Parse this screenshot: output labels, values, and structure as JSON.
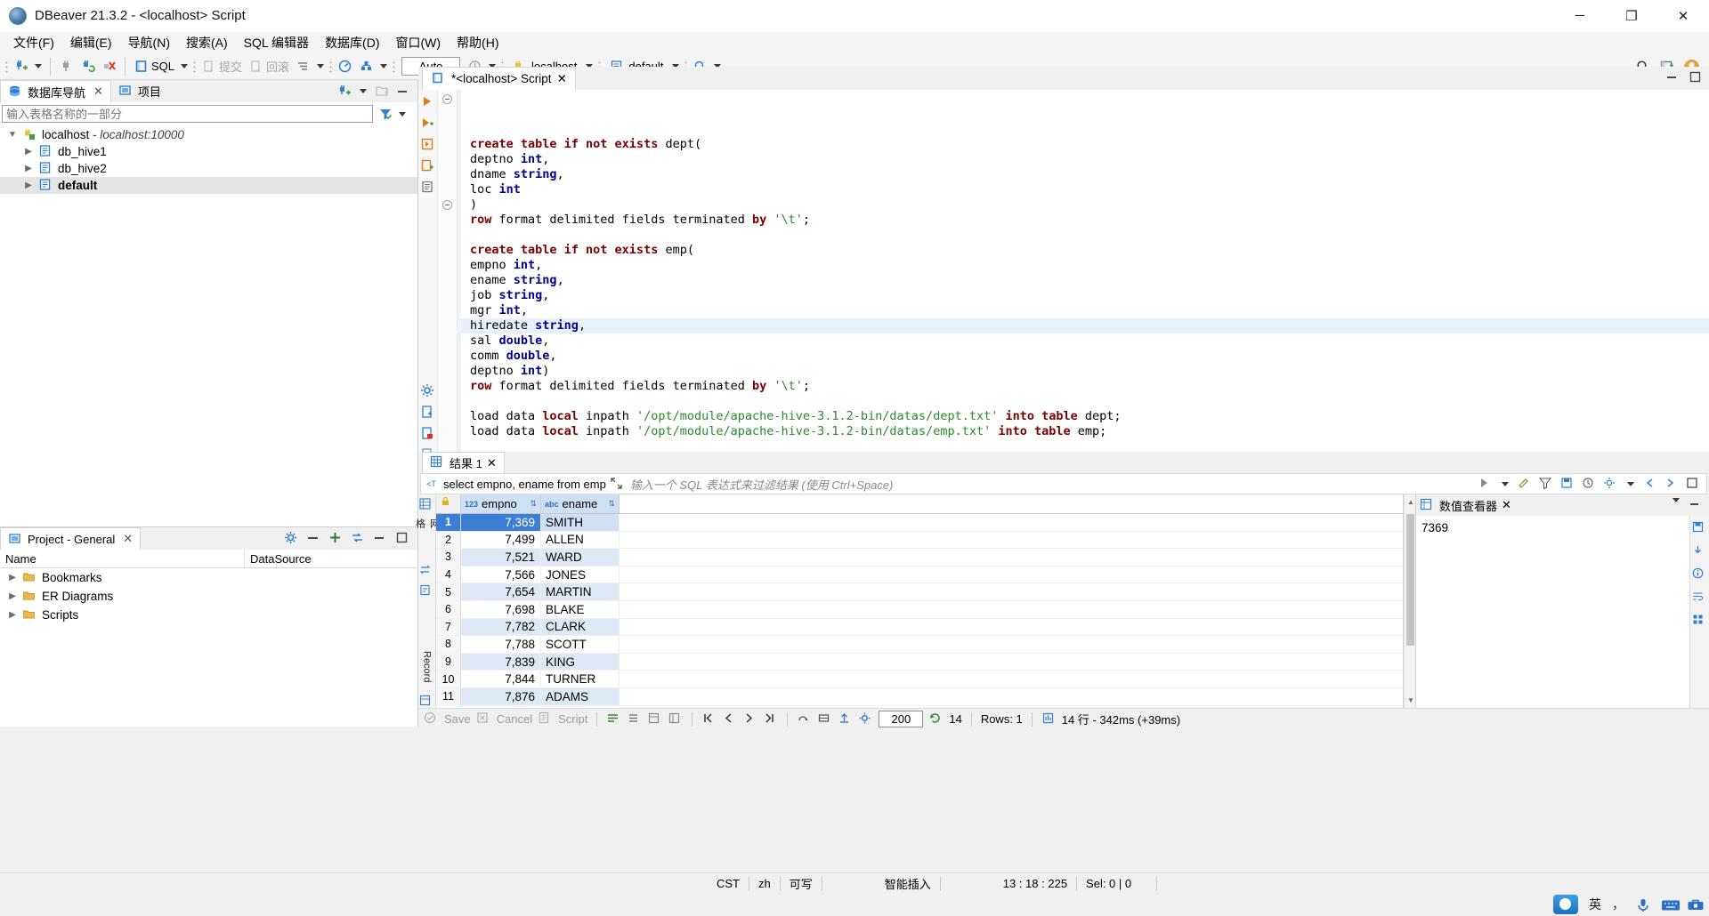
{
  "window": {
    "title": "DBeaver 21.3.2 - <localhost> Script",
    "minimize": "─",
    "maximize": "❐",
    "close": "✕"
  },
  "menubar": {
    "items": [
      {
        "label": "文件(F)"
      },
      {
        "label": "编辑(E)"
      },
      {
        "label": "导航(N)"
      },
      {
        "label": "搜索(A)"
      },
      {
        "label": "SQL 编辑器"
      },
      {
        "label": "数据库(D)"
      },
      {
        "label": "窗口(W)"
      },
      {
        "label": "帮助(H)"
      }
    ]
  },
  "toolbar": {
    "sql_label": "SQL",
    "commit_label": "提交",
    "rollback_label": "回滚",
    "auto_label": "Auto",
    "connection": "localhost",
    "schema": "default",
    "icons": {
      "new_connection": "new-connection-icon",
      "disconnect": "disconnect-icon",
      "refresh": "refresh-connection-icon",
      "invalidate": "invalidate-icon",
      "sql_editor": "sql-editor-icon",
      "commit": "commit-icon",
      "rollback": "rollback-icon",
      "transaction_mode": "transaction-mode-icon",
      "dashboard": "dashboard-icon",
      "database_manage": "database-manage-icon",
      "history": "history-icon",
      "search": "search-icon",
      "perspective": "perspective-icon",
      "user": "user-icon"
    }
  },
  "navigator": {
    "tabs": [
      {
        "label": "数据库导航",
        "icon": "database-navigator-icon",
        "active": true,
        "closable": true
      },
      {
        "label": "项目",
        "icon": "project-icon",
        "active": false,
        "closable": false
      }
    ],
    "filter_placeholder": "输入表格名称的一部分",
    "filter_value": "",
    "tree": [
      {
        "label": "localhost",
        "sub": " - localhost:10000",
        "depth": 0,
        "expanded": true,
        "icon": "connection-icon",
        "bold": false,
        "selected": false
      },
      {
        "label": "db_hive1",
        "sub": "",
        "depth": 1,
        "expanded": false,
        "icon": "database-icon",
        "bold": false,
        "selected": false
      },
      {
        "label": "db_hive2",
        "sub": "",
        "depth": 1,
        "expanded": false,
        "icon": "database-icon",
        "bold": false,
        "selected": false
      },
      {
        "label": "default",
        "sub": "",
        "depth": 1,
        "expanded": false,
        "icon": "database-icon",
        "bold": true,
        "selected": true
      }
    ]
  },
  "project": {
    "tab_label": "Project - General",
    "columns": [
      "Name",
      "DataSource"
    ],
    "rows": [
      {
        "label": "Bookmarks",
        "icon": "bookmarks-folder-icon"
      },
      {
        "label": "ER Diagrams",
        "icon": "er-diagrams-folder-icon"
      },
      {
        "label": "Scripts",
        "icon": "scripts-folder-icon"
      }
    ]
  },
  "editor": {
    "tab_label": "*<localhost> Script",
    "tab_icon": "sql-script-icon",
    "lines": [
      {
        "text": "create table if not exists dept(",
        "fold": true,
        "hl": false,
        "tokens": [
          {
            "t": "create table if not exists ",
            "c": "kw"
          },
          {
            "t": "dept(",
            "c": "pl"
          }
        ]
      },
      {
        "text": "deptno int,",
        "fold": false,
        "hl": false,
        "tokens": [
          {
            "t": "deptno ",
            "c": "pl"
          },
          {
            "t": "int",
            "c": "typ"
          },
          {
            "t": ",",
            "c": "pl"
          }
        ]
      },
      {
        "text": "dname string,",
        "fold": false,
        "hl": false,
        "tokens": [
          {
            "t": "dname ",
            "c": "pl"
          },
          {
            "t": "string",
            "c": "typ"
          },
          {
            "t": ",",
            "c": "pl"
          }
        ]
      },
      {
        "text": "loc int",
        "fold": false,
        "hl": false,
        "tokens": [
          {
            "t": "loc ",
            "c": "pl"
          },
          {
            "t": "int",
            "c": "typ"
          }
        ]
      },
      {
        "text": ")",
        "fold": false,
        "hl": false,
        "tokens": [
          {
            "t": ")",
            "c": "pl"
          }
        ]
      },
      {
        "text": "row format delimited fields terminated by '\\t';",
        "fold": false,
        "hl": false,
        "tokens": [
          {
            "t": "row",
            "c": "kw"
          },
          {
            "t": " format delimited fields terminated ",
            "c": "pl"
          },
          {
            "t": "by",
            "c": "kw"
          },
          {
            "t": " ",
            "c": "pl"
          },
          {
            "t": "'\\t'",
            "c": "str"
          },
          {
            "t": ";",
            "c": "pl"
          }
        ]
      },
      {
        "text": "",
        "fold": false,
        "hl": false,
        "tokens": []
      },
      {
        "text": "create table if not exists emp(",
        "fold": true,
        "hl": false,
        "tokens": [
          {
            "t": "create table if not exists ",
            "c": "kw"
          },
          {
            "t": "emp(",
            "c": "pl"
          }
        ]
      },
      {
        "text": "empno int,",
        "fold": false,
        "hl": false,
        "tokens": [
          {
            "t": "empno ",
            "c": "pl"
          },
          {
            "t": "int",
            "c": "typ"
          },
          {
            "t": ",",
            "c": "pl"
          }
        ]
      },
      {
        "text": "ename string,",
        "fold": false,
        "hl": false,
        "tokens": [
          {
            "t": "ename ",
            "c": "pl"
          },
          {
            "t": "string",
            "c": "typ"
          },
          {
            "t": ",",
            "c": "pl"
          }
        ]
      },
      {
        "text": "job string,",
        "fold": false,
        "hl": false,
        "tokens": [
          {
            "t": "job ",
            "c": "pl"
          },
          {
            "t": "string",
            "c": "typ"
          },
          {
            "t": ",",
            "c": "pl"
          }
        ]
      },
      {
        "text": "mgr int,",
        "fold": false,
        "hl": false,
        "tokens": [
          {
            "t": "mgr ",
            "c": "pl"
          },
          {
            "t": "int",
            "c": "typ"
          },
          {
            "t": ",",
            "c": "pl"
          }
        ]
      },
      {
        "text": "hiredate string,",
        "fold": false,
        "hl": true,
        "tokens": [
          {
            "t": "hiredate ",
            "c": "pl"
          },
          {
            "t": "string",
            "c": "typ"
          },
          {
            "t": ",",
            "c": "pl"
          }
        ]
      },
      {
        "text": "sal double,",
        "fold": false,
        "hl": false,
        "tokens": [
          {
            "t": "sal ",
            "c": "pl"
          },
          {
            "t": "double",
            "c": "typ"
          },
          {
            "t": ",",
            "c": "pl"
          }
        ]
      },
      {
        "text": "comm double,",
        "fold": false,
        "hl": false,
        "tokens": [
          {
            "t": "comm ",
            "c": "pl"
          },
          {
            "t": "double",
            "c": "typ"
          },
          {
            "t": ",",
            "c": "pl"
          }
        ]
      },
      {
        "text": "deptno int)",
        "fold": false,
        "hl": false,
        "tokens": [
          {
            "t": "deptno ",
            "c": "pl"
          },
          {
            "t": "int",
            "c": "typ"
          },
          {
            "t": ")",
            "c": "pl"
          }
        ]
      },
      {
        "text": "row format delimited fields terminated by '\\t';",
        "fold": false,
        "hl": false,
        "tokens": [
          {
            "t": "row",
            "c": "kw"
          },
          {
            "t": " format delimited fields terminated ",
            "c": "pl"
          },
          {
            "t": "by",
            "c": "kw"
          },
          {
            "t": " ",
            "c": "pl"
          },
          {
            "t": "'\\t'",
            "c": "str"
          },
          {
            "t": ";",
            "c": "pl"
          }
        ]
      },
      {
        "text": "",
        "fold": false,
        "hl": false,
        "tokens": []
      },
      {
        "text": "load data local inpath '/opt/module/apache-hive-3.1.2-bin/datas/dept.txt' into table dept;",
        "fold": false,
        "hl": false,
        "tokens": [
          {
            "t": "load data ",
            "c": "pl"
          },
          {
            "t": "local",
            "c": "kw"
          },
          {
            "t": " inpath ",
            "c": "pl"
          },
          {
            "t": "'/opt/module/apache-hive-3.1.2-bin/datas/dept.txt'",
            "c": "str"
          },
          {
            "t": " ",
            "c": "pl"
          },
          {
            "t": "into table",
            "c": "kw"
          },
          {
            "t": " dept;",
            "c": "pl"
          }
        ]
      },
      {
        "text": "load data local inpath '/opt/module/apache-hive-3.1.2-bin/datas/emp.txt' into table emp;",
        "fold": false,
        "hl": false,
        "tokens": [
          {
            "t": "load data ",
            "c": "pl"
          },
          {
            "t": "local",
            "c": "kw"
          },
          {
            "t": " inpath ",
            "c": "pl"
          },
          {
            "t": "'/opt/module/apache-hive-3.1.2-bin/datas/emp.txt'",
            "c": "str"
          },
          {
            "t": " ",
            "c": "pl"
          },
          {
            "t": "into table",
            "c": "kw"
          },
          {
            "t": " emp;",
            "c": "pl"
          }
        ]
      },
      {
        "text": "",
        "fold": false,
        "hl": false,
        "tokens": []
      },
      {
        "text": "select empno, ename from emp;",
        "fold": false,
        "hl": false,
        "tokens": [
          {
            "t": "select",
            "c": "kw"
          },
          {
            "t": " empno, ename ",
            "c": "pl"
          },
          {
            "t": "from",
            "c": "kw"
          },
          {
            "t": " emp",
            "c": "pl"
          },
          {
            "t": ";",
            "c": "pl"
          }
        ]
      }
    ]
  },
  "results": {
    "tab_label": "结果 1",
    "tab_icon": "grid-icon",
    "filter_query": "select empno, ename from emp",
    "filter_placeholder": "输入一个 SQL 表达式来过滤结果 (使用 Ctrl+Space)",
    "columns": [
      {
        "name": "empno",
        "type_badge": "123"
      },
      {
        "name": "ename",
        "type_badge": "abc"
      }
    ],
    "rows": [
      {
        "n": "1",
        "empno": "7,369",
        "ename": "SMITH"
      },
      {
        "n": "2",
        "empno": "7,499",
        "ename": "ALLEN"
      },
      {
        "n": "3",
        "empno": "7,521",
        "ename": "WARD"
      },
      {
        "n": "4",
        "empno": "7,566",
        "ename": "JONES"
      },
      {
        "n": "5",
        "empno": "7,654",
        "ename": "MARTIN"
      },
      {
        "n": "6",
        "empno": "7,698",
        "ename": "BLAKE"
      },
      {
        "n": "7",
        "empno": "7,782",
        "ename": "CLARK"
      },
      {
        "n": "8",
        "empno": "7,788",
        "ename": "SCOTT"
      },
      {
        "n": "9",
        "empno": "7,839",
        "ename": "KING"
      },
      {
        "n": "10",
        "empno": "7,844",
        "ename": "TURNER"
      },
      {
        "n": "11",
        "empno": "7,876",
        "ename": "ADAMS"
      }
    ],
    "side_labels": {
      "grid": "网格",
      "record": "Record"
    },
    "footer": {
      "save": "Save",
      "cancel": "Cancel",
      "script": "Script",
      "row_limit": "200",
      "fetch_count": "14",
      "rows_label": "Rows: 1",
      "status": "14 行 - 342ms (+39ms)"
    }
  },
  "value_viewer": {
    "title": "数值查看器",
    "value": "7369"
  },
  "statusbar": {
    "timezone": "CST",
    "language": "zh",
    "writable": "可写",
    "insert_mode": "智能插入",
    "position": "13 : 18 : 225",
    "selection": "Sel: 0 | 0"
  },
  "ime": {
    "mode": "英",
    "icons": [
      "sogou-logo-icon",
      "mic-icon",
      "keyboard-icon",
      "toolbox-icon"
    ]
  },
  "colors": {
    "accent": "#3a7fd5",
    "keyword": "#7c0000",
    "type": "#00008f",
    "string": "#2a8a2a",
    "selection": "#cfe0f5",
    "panel_bg": "#f0f0f0"
  }
}
